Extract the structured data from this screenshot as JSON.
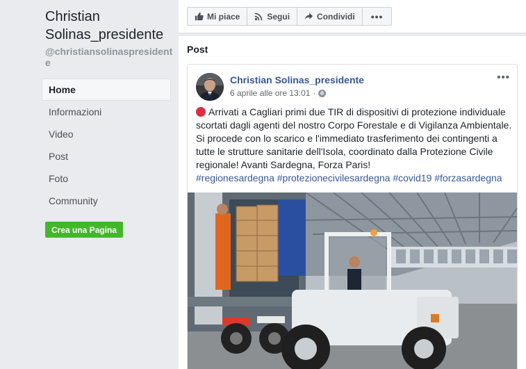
{
  "sidebar": {
    "page_name": "Christian Solinas_presidente",
    "page_handle": "@christiansolinaspresidente",
    "nav": [
      {
        "label": "Home"
      },
      {
        "label": "Informazioni"
      },
      {
        "label": "Video"
      },
      {
        "label": "Post"
      },
      {
        "label": "Foto"
      },
      {
        "label": "Community"
      }
    ],
    "create_page_label": "Crea una Pagina"
  },
  "actions": {
    "like_label": "Mi piace",
    "follow_label": "Segui",
    "share_label": "Condividi",
    "more_label": "•••"
  },
  "posts": {
    "heading": "Post",
    "author": "Christian Solinas_presidente",
    "date": "6 aprile alle ore 13:01",
    "meta_separator": "·",
    "menu_label": "•••",
    "body": "Arrivati a Cagliari primi due TIR di dispositivi di protezione individuale scortati dagli agenti del nostro Corpo Forestale e di Vigilanza Ambientale. Si procede con lo scarico e l'immediato trasferimento dei contingenti a tutte le strutture sanitarie dell'Isola, coordinato dalla Protezione Civile regionale! Avanti Sardegna, Forza Paris!",
    "hashtags": [
      "#regionesardegna",
      "#protezionecivilesardegna",
      "#covid19",
      "#forzasardegna"
    ]
  },
  "colors": {
    "link": "#365899",
    "create_button": "#42b72a",
    "background": "#e9ebee"
  }
}
